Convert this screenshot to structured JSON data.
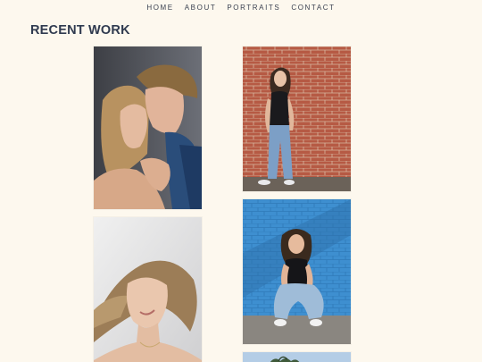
{
  "nav": {
    "items": [
      {
        "label": "HOME"
      },
      {
        "label": "ABOUT"
      },
      {
        "label": "PORTRAITS"
      },
      {
        "label": "CONTACT"
      }
    ]
  },
  "section": {
    "title": "RECENT WORK"
  },
  "gallery": {
    "photos": [
      {
        "subject": "couple portrait"
      },
      {
        "subject": "woman against brick wall"
      },
      {
        "subject": "smiling woman with windswept hair"
      },
      {
        "subject": "woman crouching against blue wall"
      },
      {
        "subject": "sky and trees"
      }
    ]
  }
}
